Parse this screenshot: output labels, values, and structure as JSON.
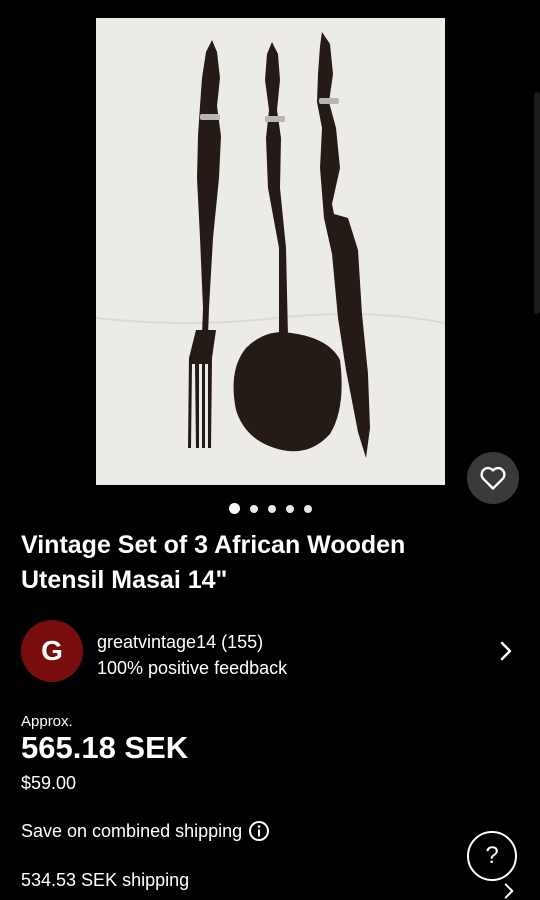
{
  "listing": {
    "title": "Vintage Set of 3 African Wooden Utensil Masai 14\"",
    "image_count": 5,
    "active_image_index": 0
  },
  "seller": {
    "initial": "G",
    "name": "greatvintage14 (155)",
    "feedback": "100% positive feedback",
    "avatar_color": "#7a0d0d"
  },
  "pricing": {
    "approx_label": "Approx.",
    "converted_price": "565.18 SEK",
    "original_price": "$59.00"
  },
  "shipping": {
    "combined_label": "Save on combined shipping",
    "shipping_cost": "534.53 SEK shipping"
  },
  "help": {
    "label": "?"
  },
  "icons": {
    "heart": "heart-icon",
    "info": "info-icon",
    "chevron": "chevron-right-icon"
  },
  "colors": {
    "background": "#000000",
    "text": "#ffffff",
    "button_bg": "#3a3a3a"
  }
}
